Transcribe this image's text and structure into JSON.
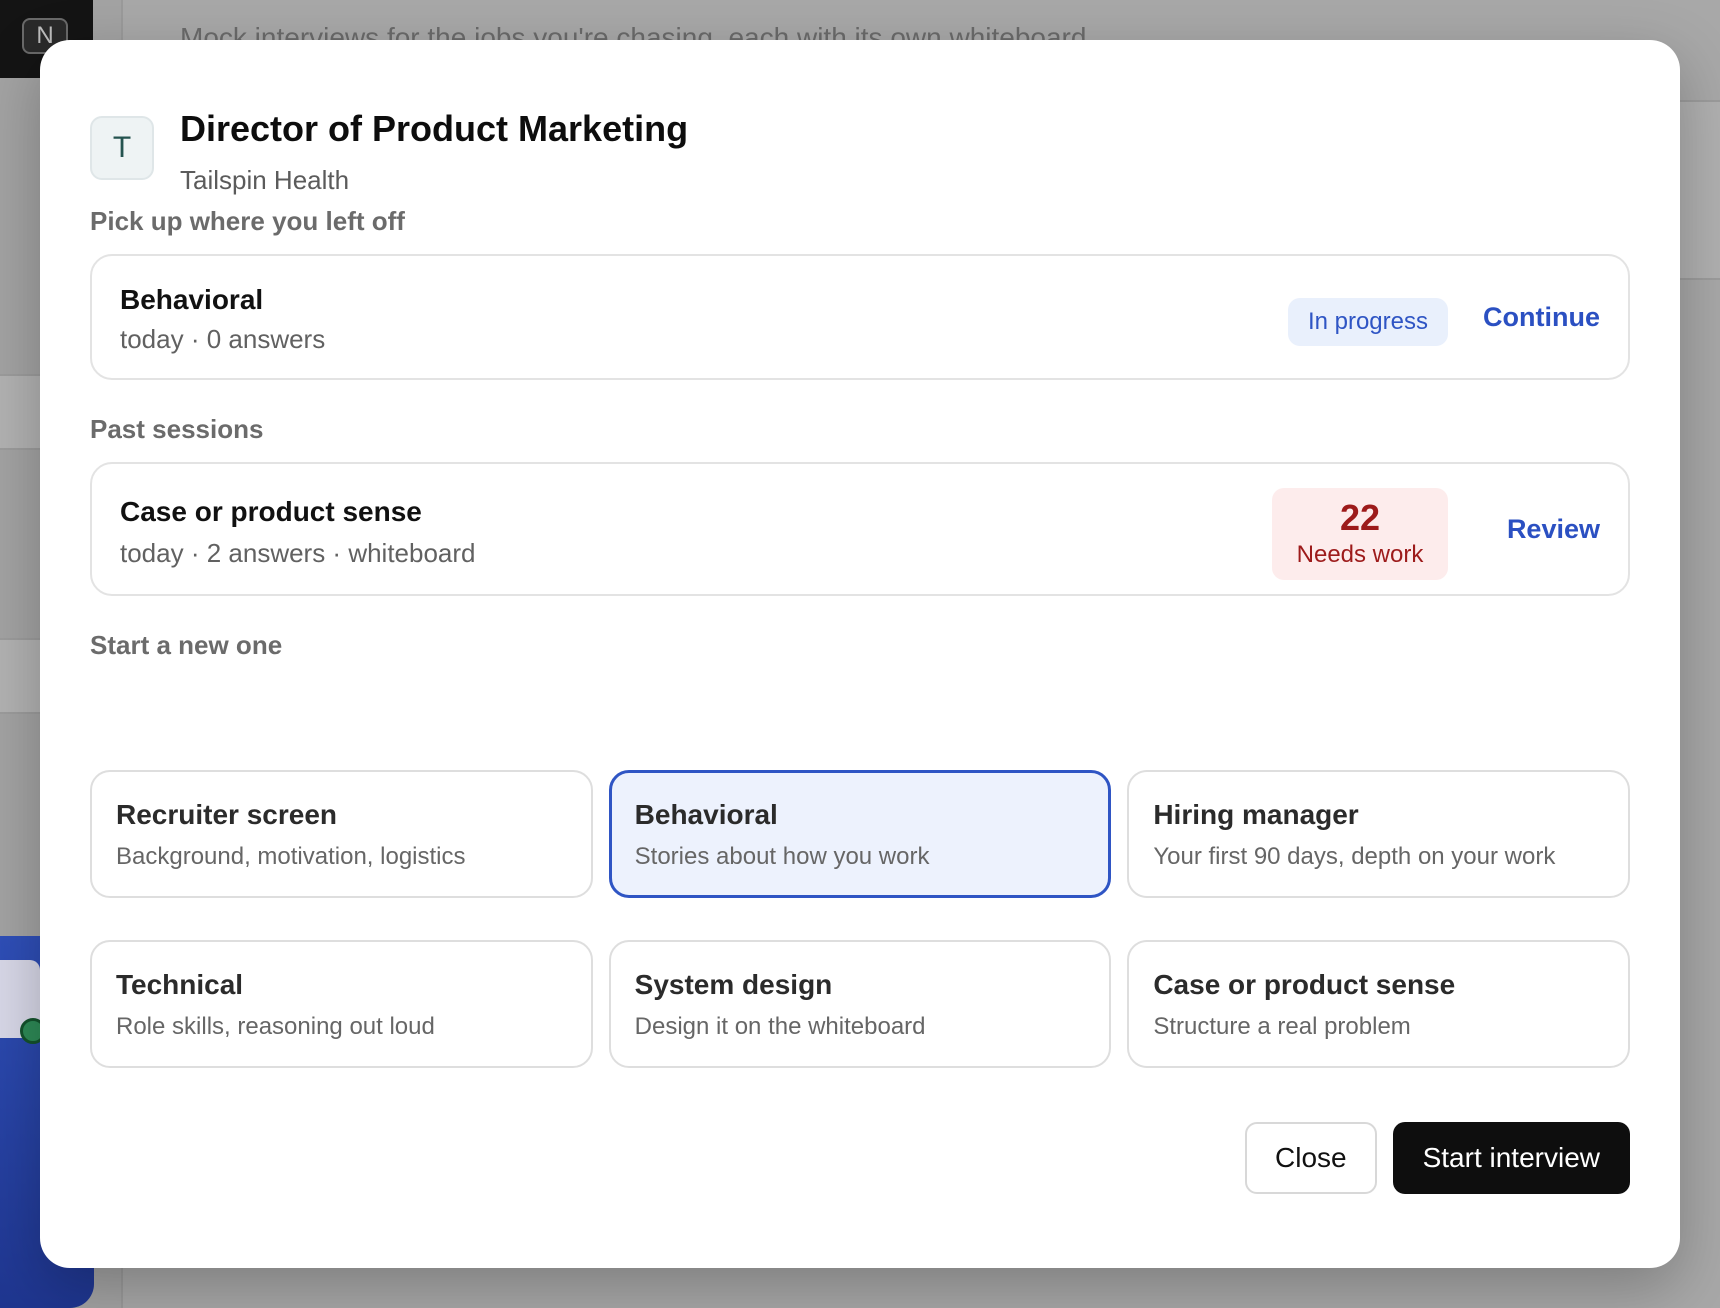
{
  "background": {
    "logo_letter": "N",
    "subtitle": "Mock interviews for the jobs you're chasing, each with its own whiteboard."
  },
  "modal": {
    "avatar_letter": "T",
    "job_title": "Director of Product Marketing",
    "company": "Tailspin Health",
    "resume_section": {
      "label": "Pick up where you left off",
      "session": {
        "name": "Behavioral",
        "meta": "today · 0 answers",
        "status": "In progress",
        "action": "Continue"
      }
    },
    "past_section": {
      "label": "Past sessions",
      "session": {
        "name": "Case or product sense",
        "meta": "today · 2 answers · whiteboard",
        "score": "22",
        "score_label": "Needs work",
        "action": "Review"
      }
    },
    "new_section": {
      "label": "Start a new one",
      "types": [
        {
          "name": "Recruiter screen",
          "desc": "Background, motivation, logistics",
          "selected": false
        },
        {
          "name": "Behavioral",
          "desc": "Stories about how you work",
          "selected": true
        },
        {
          "name": "Hiring manager",
          "desc": "Your first 90 days, depth on your work",
          "selected": false
        },
        {
          "name": "Technical",
          "desc": "Role skills, reasoning out loud",
          "selected": false
        },
        {
          "name": "System design",
          "desc": "Design it on the whiteboard",
          "selected": false
        },
        {
          "name": "Case or product sense",
          "desc": "Structure a real problem",
          "selected": false
        }
      ]
    },
    "footer": {
      "close_label": "Close",
      "start_label": "Start interview"
    }
  },
  "colors": {
    "accent": "#2f55c4",
    "selected_bg": "#edf2fd",
    "danger": "#9d1b1b",
    "danger_bg": "#fdecec",
    "primary_button": "#0e0e0e"
  }
}
